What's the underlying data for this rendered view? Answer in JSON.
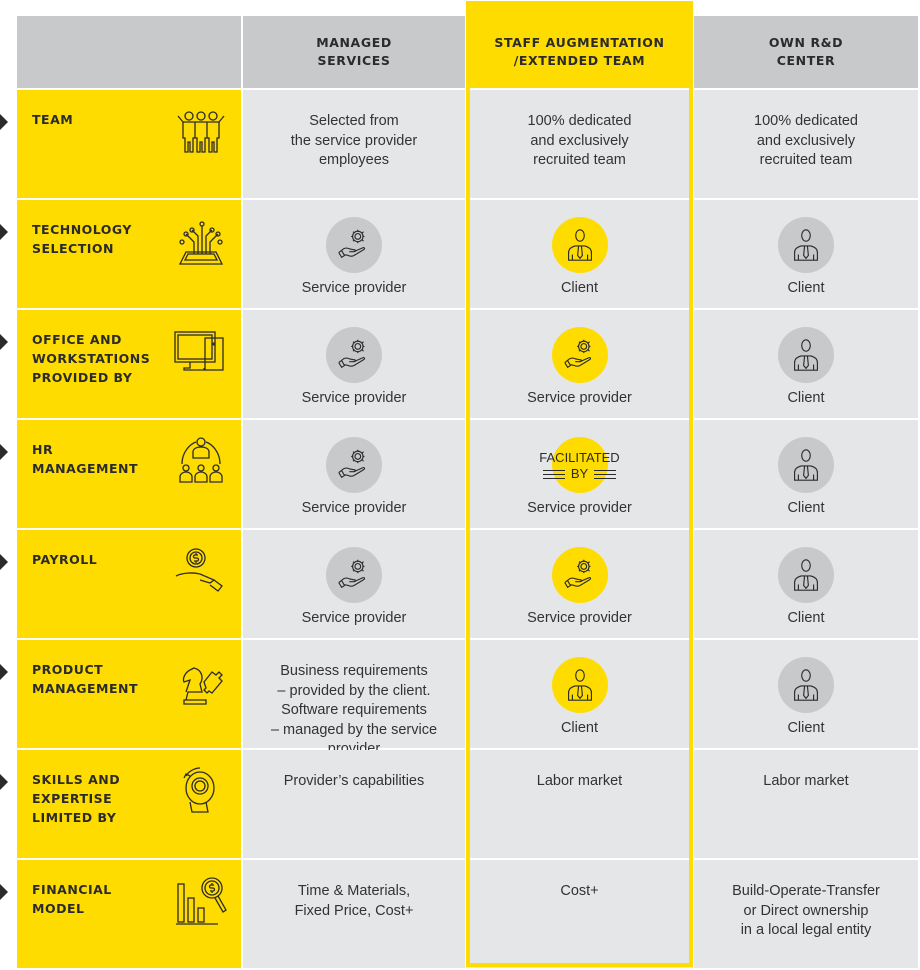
{
  "colors": {
    "accent": "#ffdc00",
    "header_gray": "#c8c9cb",
    "cell_gray": "#e5e6e8",
    "text": "#2b2b2b"
  },
  "columns": [
    {
      "label": "MANAGED\nSERVICES",
      "highlighted": false
    },
    {
      "label": "STAFF AUGMENTATION\n/EXTENDED TEAM",
      "highlighted": true
    },
    {
      "label": "OWN R&D\nCENTER",
      "highlighted": false
    }
  ],
  "rows": [
    {
      "label": "TEAM",
      "icon": "team-icon",
      "cells": [
        {
          "text": "Selected from\nthe service provider\nemployees"
        },
        {
          "text": "100% dedicated\nand exclusively\nrecruited team"
        },
        {
          "text": "100% dedicated\nand exclusively\nrecruited team"
        }
      ]
    },
    {
      "label": "TECHNOLOGY\nSELECTION",
      "icon": "circuit-icon",
      "cells": [
        {
          "badge": "hand-gear-icon",
          "badge_color": "gray",
          "text": "Service provider"
        },
        {
          "badge": "client-person-icon",
          "badge_color": "yellow",
          "text": "Client"
        },
        {
          "badge": "client-person-icon",
          "badge_color": "gray",
          "text": "Client"
        }
      ]
    },
    {
      "label": "OFFICE AND\nWORKSTATIONS\nPROVIDED BY",
      "icon": "computer-icon",
      "cells": [
        {
          "badge": "hand-gear-icon",
          "badge_color": "gray",
          "text": "Service provider"
        },
        {
          "badge": "hand-gear-icon",
          "badge_color": "yellow",
          "text": "Service provider"
        },
        {
          "badge": "client-person-icon",
          "badge_color": "gray",
          "text": "Client"
        }
      ]
    },
    {
      "label": "HR\nMANAGEMENT",
      "icon": "hr-team-icon",
      "cells": [
        {
          "badge": "hand-gear-icon",
          "badge_color": "gray",
          "text": "Service provider"
        },
        {
          "badge": "facilitated-by-stamp",
          "badge_color": "yellow",
          "stamp_top": "FACILITATED",
          "stamp_bottom": "BY",
          "text": "Service provider"
        },
        {
          "badge": "client-person-icon",
          "badge_color": "gray",
          "text": "Client"
        }
      ]
    },
    {
      "label": "PAYROLL",
      "icon": "money-hand-icon",
      "cells": [
        {
          "badge": "hand-gear-icon",
          "badge_color": "gray",
          "text": "Service provider"
        },
        {
          "badge": "hand-gear-icon",
          "badge_color": "yellow",
          "text": "Service provider"
        },
        {
          "badge": "client-person-icon",
          "badge_color": "gray",
          "text": "Client"
        }
      ]
    },
    {
      "label": "PRODUCT\nMANAGEMENT",
      "icon": "chess-puzzle-icon",
      "cells": [
        {
          "text": "Business requirements\n– provided by the client.\nSoftware requirements\n– managed by the service\nprovider"
        },
        {
          "badge": "client-person-icon",
          "badge_color": "yellow",
          "text": "Client"
        },
        {
          "badge": "client-person-icon",
          "badge_color": "gray",
          "text": "Client"
        }
      ]
    },
    {
      "label": "SKILLS AND\nEXPERTISE\nLIMITED BY",
      "icon": "head-gear-icon",
      "cells": [
        {
          "text": "Provider’s capabilities"
        },
        {
          "text": "Labor market"
        },
        {
          "text": "Labor market"
        }
      ]
    },
    {
      "label": "FINANCIAL\nMODEL",
      "icon": "chart-magnifier-icon",
      "cells": [
        {
          "text": "Time & Materials,\nFixed Price, Cost+"
        },
        {
          "text": "Cost+"
        },
        {
          "text": "Build-Operate-Transfer\nor Direct ownership\nin a local legal entity"
        }
      ]
    }
  ]
}
